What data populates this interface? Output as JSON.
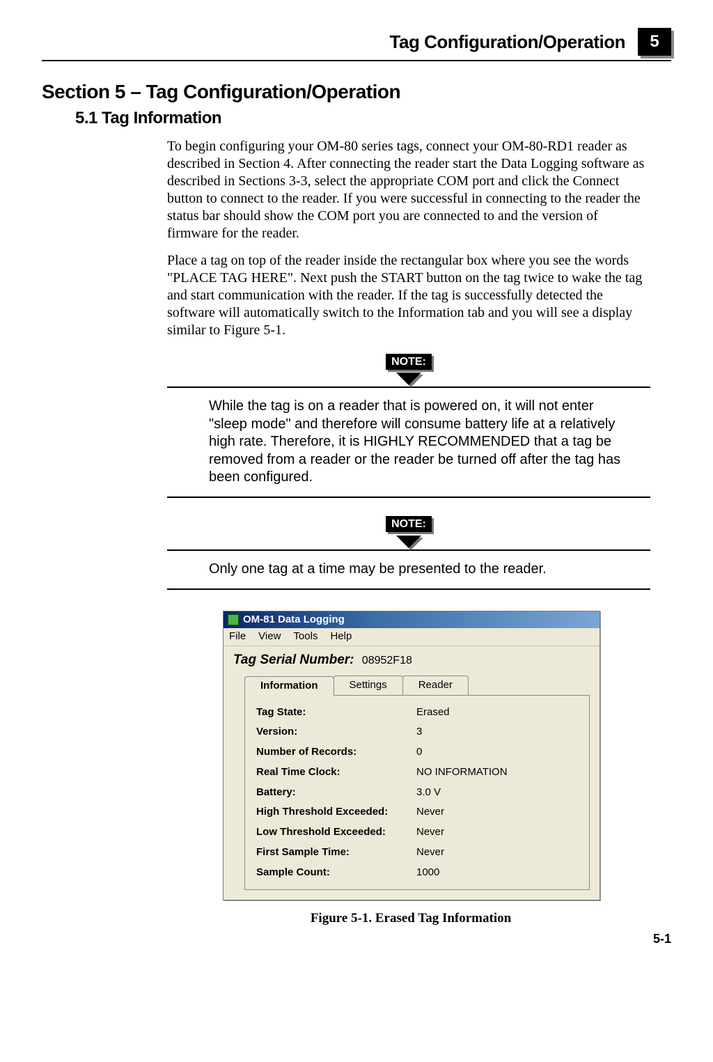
{
  "header": {
    "title": "Tag Configuration/Operation",
    "chapter": "5"
  },
  "section_title": "Section 5 – Tag Configuration/Operation",
  "subsection_title": "5.1 Tag Information",
  "paragraphs": [
    "To begin configuring your OM-80 series tags, connect your OM-80-RD1 reader as described in Section 4.  After connecting the reader start the Data Logging software as described in Sections 3-3, select the appropriate COM port and click the Connect button to connect to the reader. If you were successful in connecting to the reader the status bar should show the COM port you are connected to and the version of firmware for the reader.",
    "Place a tag on top of the reader inside the rectangular box where you see the words \"PLACE TAG HERE\". Next push the START button on the tag twice to wake the tag and start communication with the reader. If the tag is successfully detected the software will automatically switch to the Information tab and  you will see a display similar to Figure 5-1."
  ],
  "notes": [
    {
      "label": "NOTE:",
      "text": "While the tag is on a reader that is powered on, it will not enter \"sleep mode\" and therefore will consume battery life at a relatively high rate. Therefore, it is HIGHLY RECOMMENDED that a tag be removed from a reader or the reader be turned off after the tag has been  configured."
    },
    {
      "label": "NOTE:",
      "text": "Only one tag at a time may be presented to the reader."
    }
  ],
  "app": {
    "title": "OM-81 Data Logging",
    "menu": [
      "File",
      "View",
      "Tools",
      "Help"
    ],
    "serial_label": "Tag Serial Number:",
    "serial_value": "08952F18",
    "tabs": [
      "Information",
      "Settings",
      "Reader"
    ],
    "info": [
      {
        "label": "Tag State:",
        "value": "Erased"
      },
      {
        "label": "Version:",
        "value": "3"
      },
      {
        "label": "Number of Records:",
        "value": "0"
      },
      {
        "label": "Real Time Clock:",
        "value": "NO INFORMATION"
      },
      {
        "label": "Battery:",
        "value": "3.0 V"
      },
      {
        "label": "High Threshold Exceeded:",
        "value": "Never"
      },
      {
        "label": "Low Threshold Exceeded:",
        "value": "Never"
      },
      {
        "label": "First Sample Time:",
        "value": "Never"
      },
      {
        "label": "Sample Count:",
        "value": "1000"
      }
    ]
  },
  "figure_caption": "Figure 5-1.  Erased Tag Information",
  "page_number": "5-1"
}
